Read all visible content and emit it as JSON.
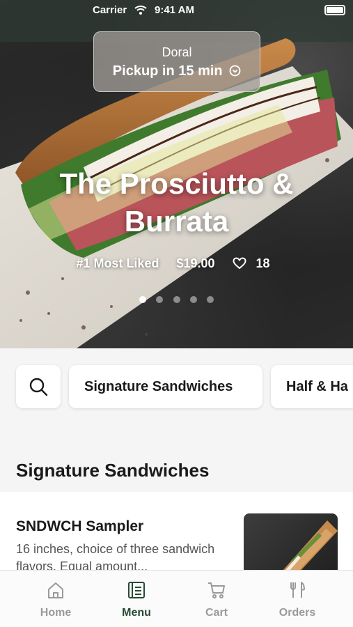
{
  "status_bar": {
    "carrier": "Carrier",
    "time": "9:41 AM"
  },
  "location": {
    "name": "Doral",
    "pickup": "Pickup in 15 min"
  },
  "hero": {
    "title": "The Prosciutto & Burrata",
    "badge": "#1 Most Liked",
    "price": "$19.00",
    "likes": "18",
    "carousel": {
      "count": 5,
      "active_index": 0
    }
  },
  "filters": {
    "chips": [
      "Signature Sandwiches",
      "Half & Ha"
    ]
  },
  "section": {
    "title": "Signature Sandwiches"
  },
  "items": [
    {
      "name": "SNDWCH Sampler",
      "description": "16 inches, choice of three sandwich flavors. Equal amount..."
    }
  ],
  "tabs": [
    {
      "label": "Home",
      "icon": "home-icon",
      "active": false
    },
    {
      "label": "Menu",
      "icon": "menu-book-icon",
      "active": true
    },
    {
      "label": "Cart",
      "icon": "cart-icon",
      "active": false
    },
    {
      "label": "Orders",
      "icon": "utensils-icon",
      "active": false
    }
  ],
  "colors": {
    "active_tab": "#274a34",
    "inactive_tab": "#9a9a9a"
  }
}
